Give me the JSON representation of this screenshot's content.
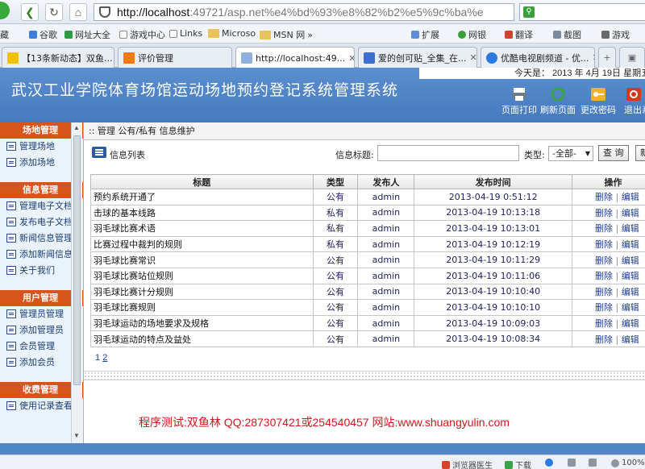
{
  "browser": {
    "url_host": "http://localhost",
    "url_rest": ":49721/asp.net%e4%bd%93%e8%82%b2%e5%9c%ba%e",
    "favorites": [
      {
        "label": "藏"
      },
      {
        "label": "谷歌"
      },
      {
        "label": "网址大全"
      },
      {
        "label": "游戏中心"
      },
      {
        "label": "Links"
      },
      {
        "label": "Microso"
      },
      {
        "label": "MSN 网"
      }
    ],
    "tools": [
      {
        "label": "扩展"
      },
      {
        "label": "网银"
      },
      {
        "label": "翻译"
      },
      {
        "label": "截图"
      },
      {
        "label": "游戏"
      }
    ],
    "tabs": [
      {
        "label": "【13条新动态】双鱼..."
      },
      {
        "label": "评价管理"
      },
      {
        "label": "http://localhost:49..."
      },
      {
        "label": "爱的创可贴_全集_在..."
      },
      {
        "label": "优酷电视剧频道 - 优..."
      }
    ],
    "status": {
      "doctor": "浏览器医生",
      "download": "下载",
      "zoom": "100%"
    }
  },
  "header": {
    "date_text": "今天是： 2013 年 4月 19日 星期五",
    "title": "武汉工业学院体育场馆运动场地预约登记系统管理系统",
    "tools": [
      {
        "label": "页面打印",
        "icon": "printer-icon",
        "color": "#6e7a87"
      },
      {
        "label": "刷新页面",
        "icon": "refresh-icon",
        "color": "#3aa24a"
      },
      {
        "label": "更改密码",
        "icon": "key-icon",
        "color": "#f0b428"
      },
      {
        "label": "退出系",
        "icon": "exit-icon",
        "color": "#d23a1e"
      }
    ]
  },
  "sidebar": {
    "groups": [
      {
        "title": "场地管理",
        "items": [
          "管理场地",
          "添加场地"
        ]
      },
      {
        "title": "信息管理",
        "items": [
          "管理电子文档",
          "发布电子文档",
          "新闻信息管理",
          "添加新闻信息",
          "关于我们"
        ]
      },
      {
        "title": "用户管理",
        "items": [
          "管理员管理",
          "添加管理员",
          "会员管理",
          "添加会员"
        ]
      },
      {
        "title": "收费管理",
        "items": [
          "使用记录查看"
        ]
      }
    ]
  },
  "content": {
    "breadcrumb": ":: 管理 公有/私有 信息维护",
    "list_label": "信息列表",
    "search_label": "信息标题:",
    "type_label": "类型:",
    "type_value": "-全部-",
    "search_button": "查 询",
    "add_button": "新",
    "columns": [
      "标题",
      "类型",
      "发布人",
      "发布时间",
      "操作"
    ],
    "delete_label": "删除",
    "edit_label": "编辑",
    "rows": [
      {
        "title": "预约系统开通了",
        "type": "公有",
        "author": "admin",
        "time": "2013-04-19 0:51:12"
      },
      {
        "title": "击球的基本线路",
        "type": "私有",
        "author": "admin",
        "time": "2013-04-19 10:13:18"
      },
      {
        "title": "羽毛球比赛术语",
        "type": "私有",
        "author": "admin",
        "time": "2013-04-19 10:13:01"
      },
      {
        "title": "比赛过程中裁判的规则",
        "type": "私有",
        "author": "admin",
        "time": "2013-04-19 10:12:19"
      },
      {
        "title": "羽毛球比赛常识",
        "type": "公有",
        "author": "admin",
        "time": "2013-04-19 10:11:29"
      },
      {
        "title": "羽毛球比赛站位规则",
        "type": "公有",
        "author": "admin",
        "time": "2013-04-19 10:11:06"
      },
      {
        "title": "羽毛球比赛计分规则",
        "type": "公有",
        "author": "admin",
        "time": "2013-04-19 10:10:40"
      },
      {
        "title": "羽毛球比赛规则",
        "type": "公有",
        "author": "admin",
        "time": "2013-04-19 10:10:10"
      },
      {
        "title": "羽毛球运动的场地要求及规格",
        "type": "公有",
        "author": "admin",
        "time": "2013-04-19 10:09:03"
      },
      {
        "title": "羽毛球运动的特点及益处",
        "type": "公有",
        "author": "admin",
        "time": "2013-04-19 10:08:34"
      }
    ],
    "pages": [
      "1",
      "2"
    ],
    "footer": "程序测试:双鱼林  QQ:287307421或254540457 网站:www.shuangyulin.com"
  }
}
